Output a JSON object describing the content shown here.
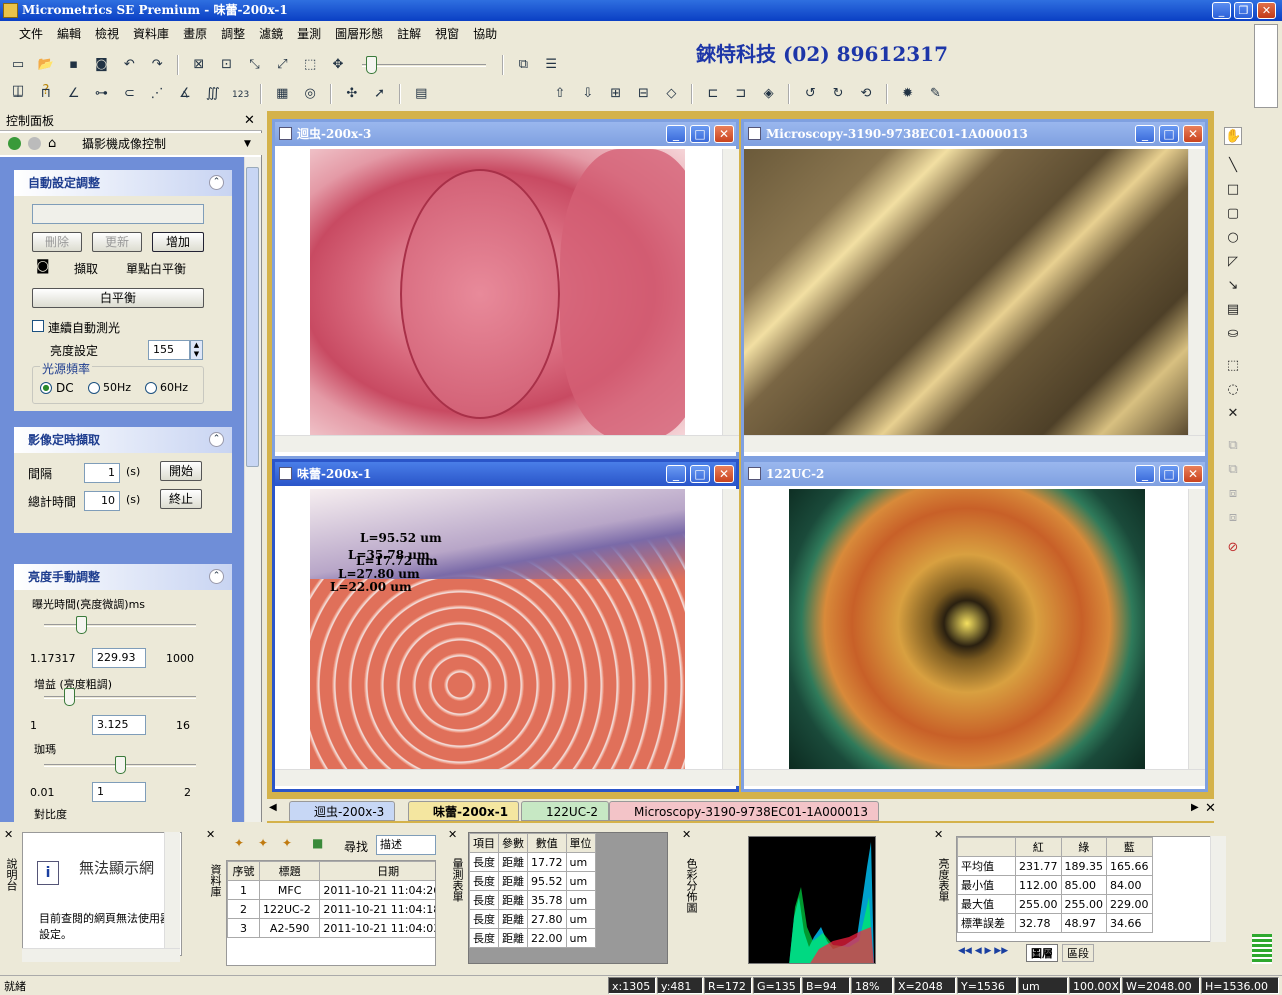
{
  "window": {
    "title": "Micrometrics SE Premium - 味蕾-200x-1"
  },
  "menu": [
    "文件",
    "編輯",
    "檢視",
    "資料庫",
    "畫原",
    "調整",
    "濾鏡",
    "量測",
    "圖層形態",
    "註解",
    "視窗",
    "協助"
  ],
  "ad_text": "錸特科技 (02) 89612317",
  "panel": {
    "title": "控制面板",
    "selector": "攝影機成像控制",
    "auto": {
      "title": "自動設定調整",
      "delete": "刪除",
      "update": "更新",
      "add": "增加",
      "capture": "擷取",
      "single_wb": "單點白平衡",
      "wb": "白平衡",
      "continuous": "連續自動測光",
      "brightness_label": "亮度設定",
      "brightness": "155",
      "freq_title": "光源頻率",
      "freq": [
        "DC",
        "50Hz",
        "60Hz"
      ]
    },
    "timed": {
      "title": "影像定時擷取",
      "interval_label": "間隔",
      "interval": "1",
      "unit": "(s)",
      "start": "開始",
      "total_label": "總計時間",
      "total": "10",
      "stop": "終止"
    },
    "manual": {
      "title": "亮度手動調整",
      "exposure_label": "曝光時間(亮度微調)ms",
      "exp_min": "1.17317",
      "exp_val": "229.93",
      "exp_max": "1000",
      "exp_level": 0.23,
      "gain_label": "增益 (亮度粗調)",
      "gain_min": "1",
      "gain_val": "3.125",
      "gain_max": "16",
      "gain_level": 0.14,
      "gamma_label": "珈瑪",
      "gamma_min": "0.01",
      "gamma_val": "1",
      "gamma_max": "2",
      "gamma_level": 0.5,
      "contrast_label": "對比度"
    }
  },
  "windows": [
    {
      "title": "迴虫-200x-3"
    },
    {
      "title": "Microscopy-3190-9738EC01-1A000013"
    },
    {
      "title": "味蕾-200x-1"
    },
    {
      "title": "122UC-2"
    }
  ],
  "measure_labels": [
    "L=95.52 um",
    "L=35.78 um",
    "L=17.72 um",
    "L=27.80 um",
    "L=22.00 um"
  ],
  "tabs": [
    "迴虫-200x-3",
    "味蕾-200x-1",
    "122UC-2",
    "Microscopy-3190-9738EC01-1A000013"
  ],
  "browser_pane": {
    "vtitle": "說明台",
    "heading": "無法顯示網",
    "body": "目前查閱的網頁無法使用器設定。"
  },
  "db_pane": {
    "vtitle": "資料庫",
    "search_label": "尋找",
    "search_field": "描述",
    "headers": [
      "序號",
      "標題",
      "日期"
    ],
    "rows": [
      [
        "1",
        "MFC",
        "2011-10-21 11:04:26"
      ],
      [
        "2",
        "122UC-2",
        "2011-10-21 11:04:18"
      ],
      [
        "3",
        "A2-590",
        "2011-10-21 11:04:03"
      ]
    ]
  },
  "measure_pane": {
    "vtitle": "量測表單",
    "headers": [
      "項目",
      "參數",
      "數值",
      "單位"
    ],
    "rows": [
      [
        "長度",
        "距離",
        "17.72",
        "um"
      ],
      [
        "長度",
        "距離",
        "95.52",
        "um"
      ],
      [
        "長度",
        "距離",
        "35.78",
        "um"
      ],
      [
        "長度",
        "距離",
        "27.80",
        "um"
      ],
      [
        "長度",
        "距離",
        "22.00",
        "um"
      ]
    ]
  },
  "hist_pane": {
    "vtitle": "色彩分佈圖"
  },
  "stats_pane": {
    "vtitle": "亮度表單",
    "headers": [
      "",
      "紅",
      "綠",
      "藍"
    ],
    "rows": [
      [
        "平均值",
        "231.77",
        "189.35",
        "165.66"
      ],
      [
        "最小值",
        "112.00",
        "85.00",
        "84.00"
      ],
      [
        "最大值",
        "255.00",
        "255.00",
        "229.00"
      ],
      [
        "標準誤差",
        "32.78",
        "48.97",
        "34.66"
      ]
    ],
    "tabs": [
      "圖層",
      "區段"
    ]
  },
  "status": {
    "ready": "就緒",
    "items": [
      "x:1305",
      "y:481",
      "R=172",
      "G=135",
      "B=94",
      "18%",
      "X=2048",
      "Y=1536",
      "um",
      "100.00X",
      "W=2048.00",
      "H=1536.00"
    ]
  }
}
